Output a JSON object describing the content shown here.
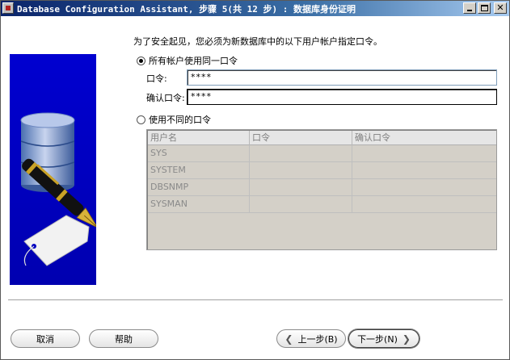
{
  "window": {
    "title": "Database Configuration Assistant, 步骤 5(共 12 步) : 数据库身份证明"
  },
  "instruction": "为了安全起见，您必须为新数据库中的以下用户帐户指定口令。",
  "same_password": {
    "label": "所有帐户使用同一口令",
    "selected": true,
    "password_label": "口令:",
    "password_value": "****",
    "confirm_label": "确认口令:",
    "confirm_value": "****"
  },
  "different_password": {
    "label": "使用不同的口令",
    "selected": false,
    "table": {
      "columns": [
        "用户名",
        "口令",
        "确认口令"
      ],
      "rows": [
        {
          "user": "SYS",
          "password": "",
          "confirm": ""
        },
        {
          "user": "SYSTEM",
          "password": "",
          "confirm": ""
        },
        {
          "user": "DBSNMP",
          "password": "",
          "confirm": ""
        },
        {
          "user": "SYSMAN",
          "password": "",
          "confirm": ""
        }
      ]
    }
  },
  "buttons": {
    "cancel": "取消",
    "help": "帮助",
    "back": "上一步(B)",
    "next": "下一步(N)"
  },
  "colors": {
    "title_bar": "#0a246a",
    "art_background": "#0000c8",
    "disabled_text": "#808080"
  }
}
